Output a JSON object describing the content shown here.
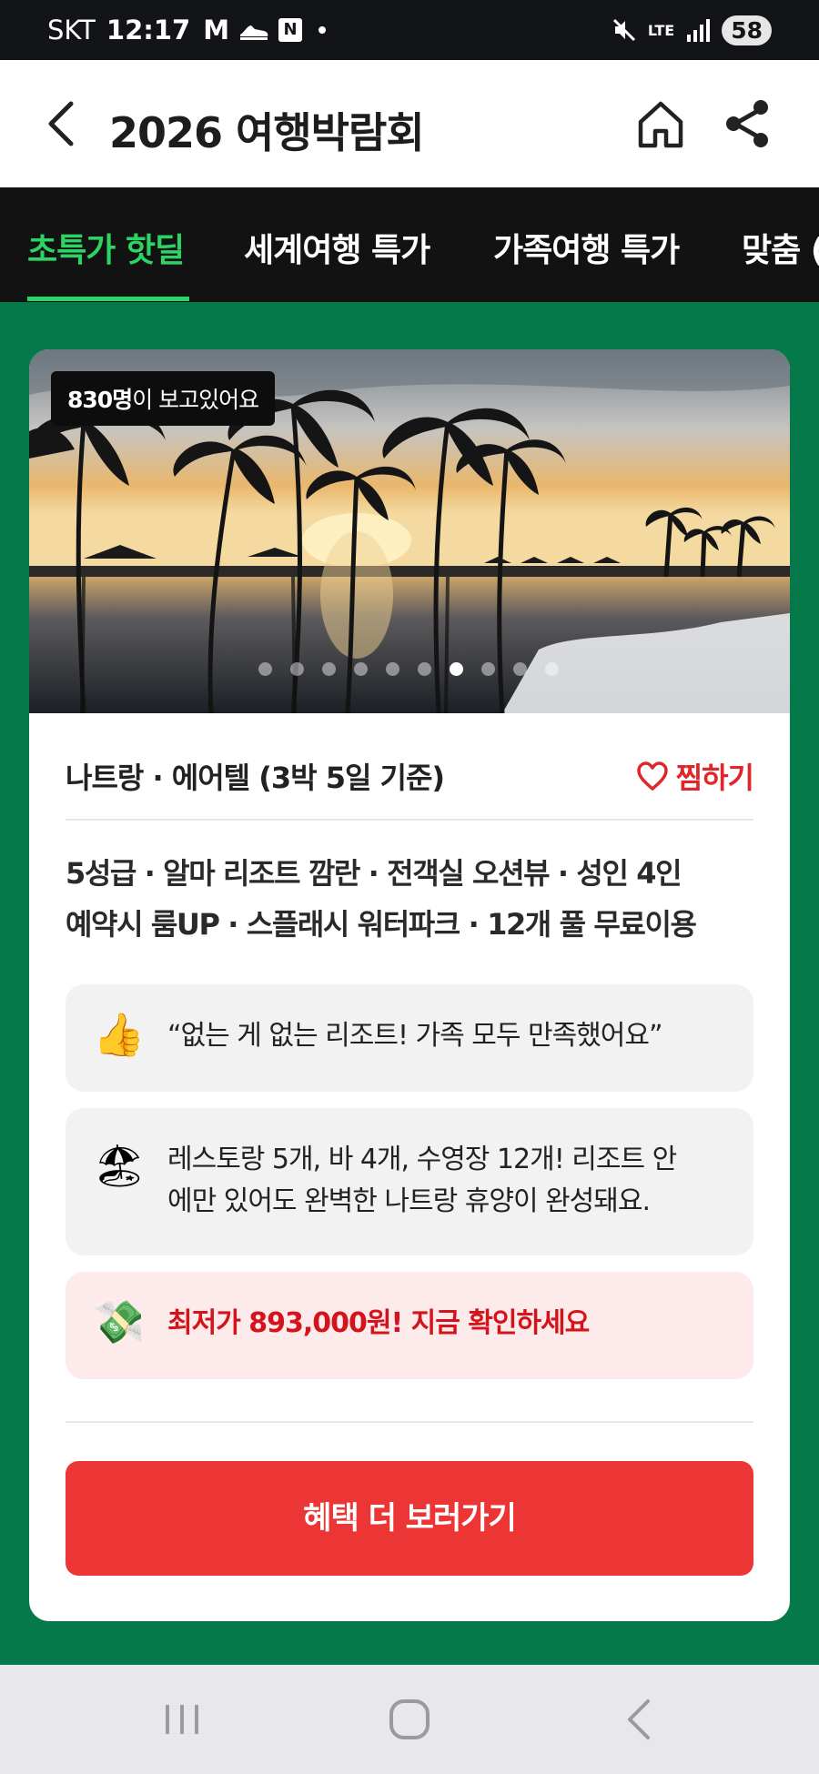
{
  "status_bar": {
    "carrier": "SKT",
    "time": "12:17",
    "app_icons": [
      "M",
      "N"
    ],
    "network": "LTE",
    "battery": "58"
  },
  "header": {
    "title": "2026 여행박람회",
    "icons": [
      "back-icon",
      "home-icon",
      "share-icon"
    ]
  },
  "tabs": [
    {
      "label": "초특가 핫딜",
      "active": true
    },
    {
      "label": "세계여행 특가",
      "active": false
    },
    {
      "label": "가족여행 특가",
      "active": false
    },
    {
      "label": "맞춤 (",
      "active": false
    }
  ],
  "card": {
    "viewer_count": "830명",
    "viewer_suffix": "이 보고있어요",
    "carousel": {
      "total": 10,
      "active_index": 6
    },
    "location": "나트랑 · 에어텔 (3박 5일 기준)",
    "wishlist_label": "찜하기",
    "description_line1": "5성급 · 알마 리조트 깜란 · 전객실 오션뷰 · 성인 4인",
    "description_line2": "예약시 룸UP · 스플래시 워터파크 · 12개 풀 무료이용",
    "review": {
      "emoji": "👍",
      "text": "“없는 게 없는 리조트! 가족 모두 만족했어요”"
    },
    "facilities": {
      "emoji": "🏖",
      "line1": "레스토랑 5개, 바 4개, 수영장 12개! 리조트 안",
      "line2": "에만 있어도 완벽한 나트랑 휴양이 완성돼요."
    },
    "price": {
      "emoji": "💸",
      "text": "최저가 893,000원! 지금 확인하세요"
    },
    "cta_label": "혜택 더 보러가기"
  },
  "colors": {
    "page_background": "#06794a",
    "tab_active": "#2bd463",
    "accent_red": "#ec3535",
    "price_text": "#d4141c"
  }
}
